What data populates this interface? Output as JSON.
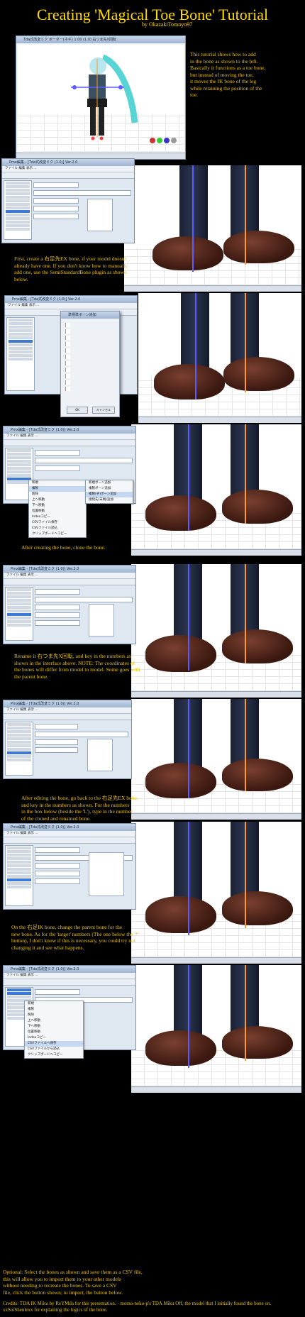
{
  "header": {
    "title": "Creating 'Magical Toe Bone' Tutorial",
    "byline": "by OkazakiTomoyo97"
  },
  "intro": {
    "window_title": "Tda式改変ミク ボーダー(ネギ) 1.00 (1.0) 右つま先X回転",
    "text": "This tutorial shows how to add\nin the bone as shown to the left.\nBasically it functions as a toe bone,\nbut instead of moving the toe,\nit moves the IK bone of the leg\nwhile retaining the position of the\ntoe."
  },
  "steps": [
    {
      "window_title": "Pmx編集 - [Tda式改変ミク (1.0)] Ver.2.0",
      "caption": "First, create a 右足先EX bone, if your model doesn't\nalready have one. If you don't know how to manually\nadd one, use the SemiStandardBone plugin as shown\nbelow."
    },
    {
      "window_title": "Pmx編集 - [Tda式改変ミク (1.0)] Ver.2.0",
      "caption": ""
    },
    {
      "window_title": "Pmx編集 - [Tda式改変ミク (1.0)] Ver.2.0",
      "caption": "After creating the bone, clone the bone."
    },
    {
      "window_title": "Pmx編集 - [Tda式改変ミク (1.0)] Ver.2.0",
      "caption": "Rename it 右つま先X回転, and key in the numbers as\nshown in the interface above. NOTE: The coordinates of\nthe bones will differ from model to model. Some goes with\nthe parent bone."
    },
    {
      "window_title": "Pmx編集 - [Tda式改変ミク (1.0)] Ver.2.0",
      "caption": "After editing the bone, go back to the 右足先EX bone,\nand key in the numbers as shown. For the numbers\nin the box below (beside the 'L'), type in the number\nof the cloned and renamed bone."
    },
    {
      "window_title": "Pmx編集 - [Tda式改変ミク (1.0)] Ver.2.0",
      "caption": "On the 右足IK bone, change the parent bone for the\nnew bone. As for the 'target' numbers (The one below the '*'\nbutton), I don't know if this is necessary, you could try not\nchanging it and see what happens."
    },
    {
      "window_title": "Pmx編集 - [Tda式改変ミク (1.0)] Ver.2.0",
      "caption": "Optional: Select the bones as shown and save them as a CSV file,\nthis will allow you to import them to your other models\nwithout needing to recreate the bones. To save a CSV\nfile, click the button shown; to import, the button below."
    }
  ],
  "menus": {
    "clone_menu": [
      "新規",
      "複製",
      "削除",
      "上へ移動",
      "下へ移動",
      "位置移動",
      "Indexコピー",
      "CSVファイル保存",
      "CSVファイル読込",
      "クリップボードへコピー"
    ],
    "clone_submenu": [
      "新規ボーン追加",
      "複製ボーン追加",
      "複製(子)ボーン追加",
      "接続先(末端)追加"
    ],
    "csv_menu": [
      "新規",
      "複製",
      "削除",
      "上へ移動",
      "下へ移動",
      "位置移動",
      "Indexコピー",
      "CSVファイルへ保存",
      "CSVファイルから読込",
      "クリップボードへコピー"
    ]
  },
  "dialog": {
    "title": "準標準ボーン追加",
    "ok_label": "OK",
    "cancel_label": "キャンセル",
    "options": [
      "全ての親",
      "上半身2",
      "腕捩れ",
      "手捩れ",
      "足IK親",
      "足先EX",
      "肩キャンセル",
      "親指0",
      "腰キャンセル",
      "グルーブ",
      "センター"
    ]
  },
  "footer": {
    "text": "Credits: TDA IK Miku by ReYMda for this presentation. · momo-neko-p's TDA Miku Off, the model that I initially found the bone on.\nxxSotShenlexx for explaining the logics of the bone."
  }
}
